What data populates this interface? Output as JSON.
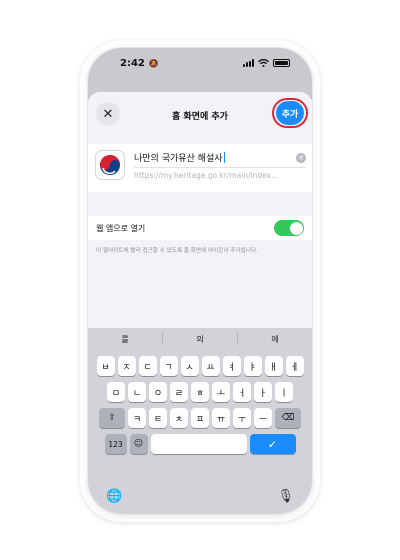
{
  "status_bar": {
    "time": "2:42"
  },
  "sheet": {
    "title": "홈 화면에 추가",
    "add_label": "추가",
    "close_label": "✕"
  },
  "app": {
    "name_value": "나만의 국가유산 해설사",
    "url_value": "https://my.heritage.go.kr/main/index...",
    "open_as_web_app_label": "웹 앱으로 열기",
    "open_as_web_app_on": true,
    "description": "이 웹사이트에 빨리 접근할 수 있도록 홈 화면에 아이콘이 추가됩니다."
  },
  "keyboard": {
    "suggestions": [
      "를",
      "의",
      "에"
    ],
    "row1": [
      "ㅂ",
      "ㅈ",
      "ㄷ",
      "ㄱ",
      "ㅅ",
      "ㅛ",
      "ㅕ",
      "ㅑ",
      "ㅐ",
      "ㅔ"
    ],
    "row2": [
      "ㅁ",
      "ㄴ",
      "ㅇ",
      "ㄹ",
      "ㅎ",
      "ㅗ",
      "ㅓ",
      "ㅏ",
      "ㅣ"
    ],
    "row3": [
      "ㅋ",
      "ㅌ",
      "ㅊ",
      "ㅍ",
      "ㅠ",
      "ㅜ",
      "ㅡ"
    ],
    "numbers_label": "123",
    "return_label": "✓"
  },
  "colors": {
    "accent": "#1a8cff",
    "highlight_ring": "#d8283a",
    "toggle_on": "#34c759"
  }
}
